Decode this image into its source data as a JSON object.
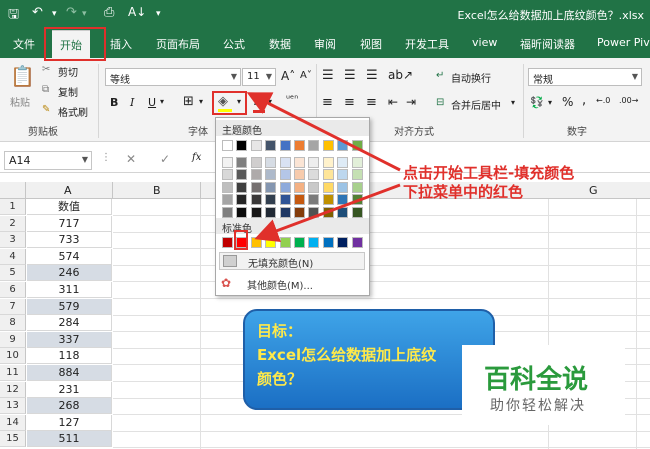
{
  "title_bar": {
    "document_title": "Excel怎么给数据加上底纹颜色？.xlsx"
  },
  "tabs": [
    "文件",
    "开始",
    "插入",
    "页面布局",
    "公式",
    "数据",
    "审阅",
    "视图",
    "开发工具",
    "view",
    "福昕阅读器",
    "Power Pivot"
  ],
  "ribbon": {
    "clipboard": {
      "paste": "粘贴",
      "cut": "剪切",
      "copy": "复制",
      "format_painter": "格式刷",
      "group": "剪贴板"
    },
    "font": {
      "name": "等线",
      "size": "11",
      "bold": "B",
      "italic": "I",
      "underline": "U",
      "group": "字体"
    },
    "alignment": {
      "wrap": "自动换行",
      "merge": "合并后居中",
      "group": "对齐方式"
    },
    "number": {
      "format": "常规",
      "percent": "%",
      "comma": ",",
      "group": "数字"
    }
  },
  "formula_bar": {
    "name_box": "A14",
    "fx": "fx"
  },
  "columns": [
    "A",
    "B",
    "G"
  ],
  "header_cell": "数值",
  "rows": [
    {
      "num": "1",
      "value": "数值"
    },
    {
      "num": "2",
      "value": "717"
    },
    {
      "num": "3",
      "value": "733"
    },
    {
      "num": "4",
      "value": "574"
    },
    {
      "num": "5",
      "value": "246"
    },
    {
      "num": "6",
      "value": "311"
    },
    {
      "num": "7",
      "value": "579"
    },
    {
      "num": "8",
      "value": "284"
    },
    {
      "num": "9",
      "value": "337"
    },
    {
      "num": "10",
      "value": "118"
    },
    {
      "num": "11",
      "value": "884"
    },
    {
      "num": "12",
      "value": "231"
    },
    {
      "num": "13",
      "value": "268"
    },
    {
      "num": "14",
      "value": "127"
    },
    {
      "num": "15",
      "value": "511"
    }
  ],
  "dropdown": {
    "theme_colors": "主题颜色",
    "standard_colors": "标准色",
    "no_fill": "无填充颜色(N)",
    "more_colors": "其他颜色(M)..."
  },
  "theme_palette": [
    [
      "#ffffff",
      "#000000",
      "#e7e6e6",
      "#44546a",
      "#4472c4",
      "#ed7d31",
      "#a5a5a5",
      "#ffc000",
      "#5b9bd5",
      "#70ad47"
    ],
    [
      "#f2f2f2",
      "#7f7f7f",
      "#d0cece",
      "#d6dce4",
      "#d9e2f3",
      "#fbe5d5",
      "#ededed",
      "#fff2cc",
      "#deebf6",
      "#e2efd9"
    ],
    [
      "#d8d8d8",
      "#595959",
      "#aeaaaa",
      "#adb9ca",
      "#b4c6e7",
      "#f7cbac",
      "#dbdbdb",
      "#fee599",
      "#bdd7ee",
      "#c5e0b3"
    ],
    [
      "#bfbfbf",
      "#3f3f3f",
      "#757070",
      "#8496b0",
      "#8eaadb",
      "#f4b183",
      "#c9c9c9",
      "#ffd965",
      "#9cc3e5",
      "#a8d08d"
    ],
    [
      "#a5a5a5",
      "#262626",
      "#3a3838",
      "#323f4f",
      "#2f5496",
      "#c55a11",
      "#7b7b7b",
      "#bf9000",
      "#2e75b5",
      "#538135"
    ],
    [
      "#7f7f7f",
      "#0c0c0c",
      "#171616",
      "#222a35",
      "#1f3864",
      "#833c0b",
      "#525252",
      "#7f6000",
      "#1e4e79",
      "#375623"
    ]
  ],
  "standard_palette": [
    "#c00000",
    "#ff0000",
    "#ffc000",
    "#ffff00",
    "#92d050",
    "#00b050",
    "#00b0f0",
    "#0070c0",
    "#002060",
    "#7030a0"
  ],
  "annotation": {
    "line1": "点击开始工具栏-填充颜色",
    "line2": "下拉菜单中的红色"
  },
  "goal": {
    "line1": "目标：",
    "line2": "Excel怎么给数据加上底纹",
    "line3": "颜色？"
  },
  "brand": {
    "name": "百科全说",
    "slogan": "助你轻松解决"
  },
  "colors": {
    "excel_green": "#217346",
    "highlight_red": "#e0302b",
    "shaded_cell": "#d6dce4"
  }
}
